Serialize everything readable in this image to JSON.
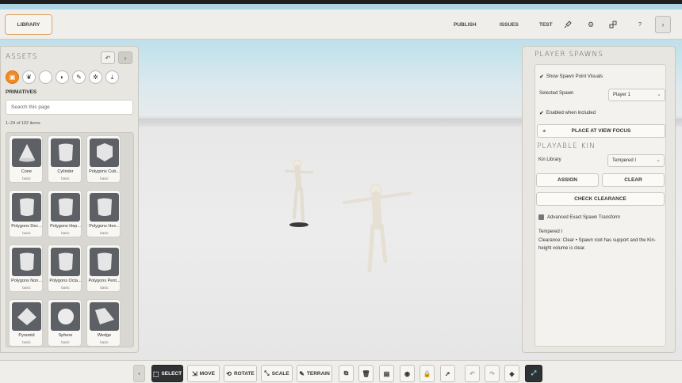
{
  "topbar": {
    "library_label": "LIBRARY",
    "nav": [
      "PUBLISH",
      "ISSUES",
      "TEST"
    ],
    "help_label": "?"
  },
  "assets": {
    "title": "ASSETS",
    "section": "PRIMATIVES",
    "search_placeholder": "Search this page",
    "count": "1–24 of 102 items",
    "items": [
      {
        "name": "Cone",
        "tag": "basic",
        "shape": "cone"
      },
      {
        "name": "Cylinder",
        "tag": "basic",
        "shape": "cylinder"
      },
      {
        "name": "Polygons Cub...",
        "tag": "basic",
        "shape": "cube"
      },
      {
        "name": "Polygons Dec...",
        "tag": "basic",
        "shape": "cylinder"
      },
      {
        "name": "Polygons Hep...",
        "tag": "basic",
        "shape": "cylinder"
      },
      {
        "name": "Polygons Hex...",
        "tag": "basic",
        "shape": "cylinder"
      },
      {
        "name": "Polygons Non...",
        "tag": "basic",
        "shape": "cylinder"
      },
      {
        "name": "Polygons Octa...",
        "tag": "basic",
        "shape": "cylinder"
      },
      {
        "name": "Polygons Pent...",
        "tag": "basic",
        "shape": "cylinder"
      },
      {
        "name": "Pyramid",
        "tag": "basic",
        "shape": "pyramid"
      },
      {
        "name": "Sphere",
        "tag": "basic",
        "shape": "sphere"
      },
      {
        "name": "Wedge",
        "tag": "basic",
        "shape": "wedge"
      }
    ]
  },
  "spawns": {
    "title": "PLAYER SPAWNS",
    "show_visuals": "Show Spawn Point Visuals",
    "selected_spawn_label": "Selected Spawn",
    "selected_spawn_value": "Player 1",
    "enabled_label": "Enabled when included",
    "place_button": "PLACE AT VIEW FOCUS",
    "kin_title": "PLAYABLE KIN",
    "kin_library_label": "Kin Library",
    "kin_library_value": "Tempered I",
    "assign_button": "ASSIGN",
    "clear_button": "CLEAR",
    "check_button": "CHECK CLEARANCE",
    "advanced_label": "Advanced Exact Spawn Transform",
    "status_name": "Tempered I",
    "status_text": "Clearance: Clear • Spawn root has support and the Kin-height volume is clear."
  },
  "toolbar": {
    "select": "SELECT",
    "move": "MOVE",
    "rotate": "ROTATE",
    "scale": "SCALE",
    "terrain": "TERRAIN"
  },
  "colors": {
    "accent": "#f08a24",
    "selected_tool": "#2f3234"
  }
}
